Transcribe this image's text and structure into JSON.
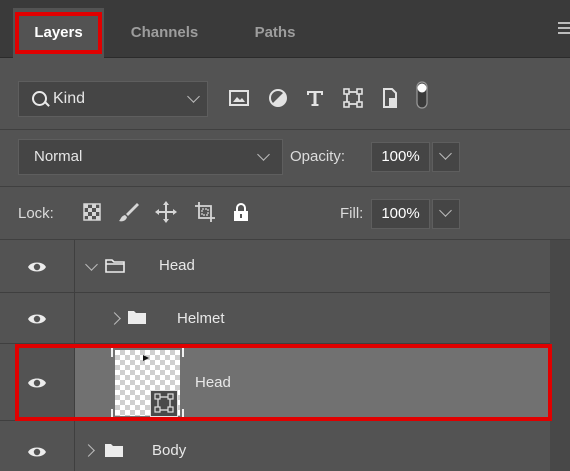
{
  "tabs": [
    {
      "label": "Layers",
      "active": true
    },
    {
      "label": "Channels",
      "active": false
    },
    {
      "label": "Paths",
      "active": false
    }
  ],
  "filter": {
    "kind_label": "Kind",
    "icons": [
      "image-filter-icon",
      "adjustment-filter-icon",
      "type-filter-icon",
      "shape-filter-icon",
      "smart-object-filter-icon",
      "filter-toggle-icon"
    ]
  },
  "blend": {
    "mode": "Normal",
    "opacity_label": "Opacity:",
    "opacity_value": "100%"
  },
  "lock": {
    "label": "Lock:",
    "icons": [
      "lock-transparent-pixels-icon",
      "lock-image-pixels-icon",
      "lock-position-icon",
      "lock-artboard-icon",
      "lock-all-icon"
    ],
    "fill_label": "Fill:",
    "fill_value": "100%"
  },
  "layers": [
    {
      "name": "Head",
      "type": "group",
      "expanded": true,
      "indent": 0,
      "selected": false
    },
    {
      "name": "Helmet",
      "type": "group",
      "expanded": false,
      "indent": 1,
      "selected": false
    },
    {
      "name": "Head",
      "type": "smart-object",
      "indent": 1,
      "selected": true
    },
    {
      "name": "Body",
      "type": "group",
      "expanded": false,
      "indent": 0,
      "selected": false
    }
  ],
  "colors": {
    "panel_bg": "#535353",
    "tabbar_bg": "#3a3a3a",
    "selected_row": "#717171",
    "highlight": "#e00000"
  }
}
